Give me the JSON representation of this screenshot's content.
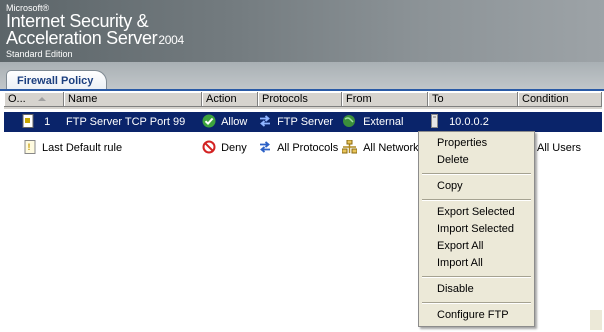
{
  "branding": {
    "microsoft": "Microsoft®",
    "title_line1": "Internet Security &",
    "title_line2": "Acceleration Server",
    "year": "2004",
    "edition": "Standard Edition"
  },
  "tab": {
    "label": "Firewall Policy"
  },
  "columns": {
    "order": "O...",
    "name": "Name",
    "action": "Action",
    "protocols": "Protocols",
    "from": "From",
    "to": "To",
    "condition": "Condition"
  },
  "rows": [
    {
      "order": "1",
      "name": "FTP Server TCP Port 99",
      "action": "Allow",
      "protocols": "FTP Server",
      "from": "External",
      "to": "10.0.0.2",
      "condition": ""
    },
    {
      "order": "",
      "name": "Last Default rule",
      "action": "Deny",
      "protocols": "All Protocols",
      "from": "All Networks",
      "to": "",
      "condition": "All Users"
    }
  ],
  "context_menu": {
    "properties": "Properties",
    "delete": "Delete",
    "copy": "Copy",
    "export_selected": "Export Selected",
    "import_selected": "Import Selected",
    "export_all": "Export All",
    "import_all": "Import All",
    "disable": "Disable",
    "configure_ftp": "Configure FTP"
  },
  "colors": {
    "selection": "#0a246a",
    "tab_text": "#1b3f7f",
    "allow": "#3da33d",
    "deny": "#d32222"
  }
}
